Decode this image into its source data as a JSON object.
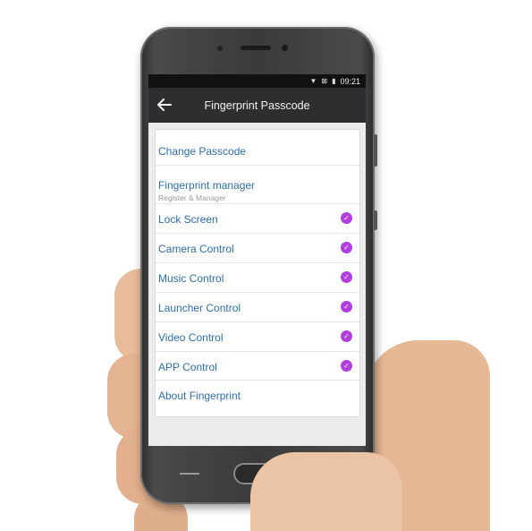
{
  "status_bar": {
    "time": "09:21",
    "icons": [
      "wifi-icon",
      "no-sim-icon",
      "battery-icon"
    ]
  },
  "app_bar": {
    "title": "Fingerprint Passcode",
    "back_icon": "back-arrow-icon"
  },
  "settings": {
    "change_passcode": {
      "label": "Change Passcode"
    },
    "fingerprint_manager": {
      "label": "Fingerprint manager",
      "sublabel": "Register & Manager"
    },
    "lock_screen": {
      "label": "Lock Screen",
      "checked": true
    },
    "camera_control": {
      "label": "Camera Control",
      "checked": true
    },
    "music_control": {
      "label": "Music Control",
      "checked": true
    },
    "launcher_control": {
      "label": "Launcher Control",
      "checked": true
    },
    "video_control": {
      "label": "Video Control",
      "checked": true
    },
    "app_control": {
      "label": "APP Control",
      "checked": true
    },
    "about_fingerprint": {
      "label": "About Fingerprint"
    }
  },
  "colors": {
    "link": "#2e6fab",
    "check": "#b33ee0",
    "appbar": "#2e2e30"
  }
}
